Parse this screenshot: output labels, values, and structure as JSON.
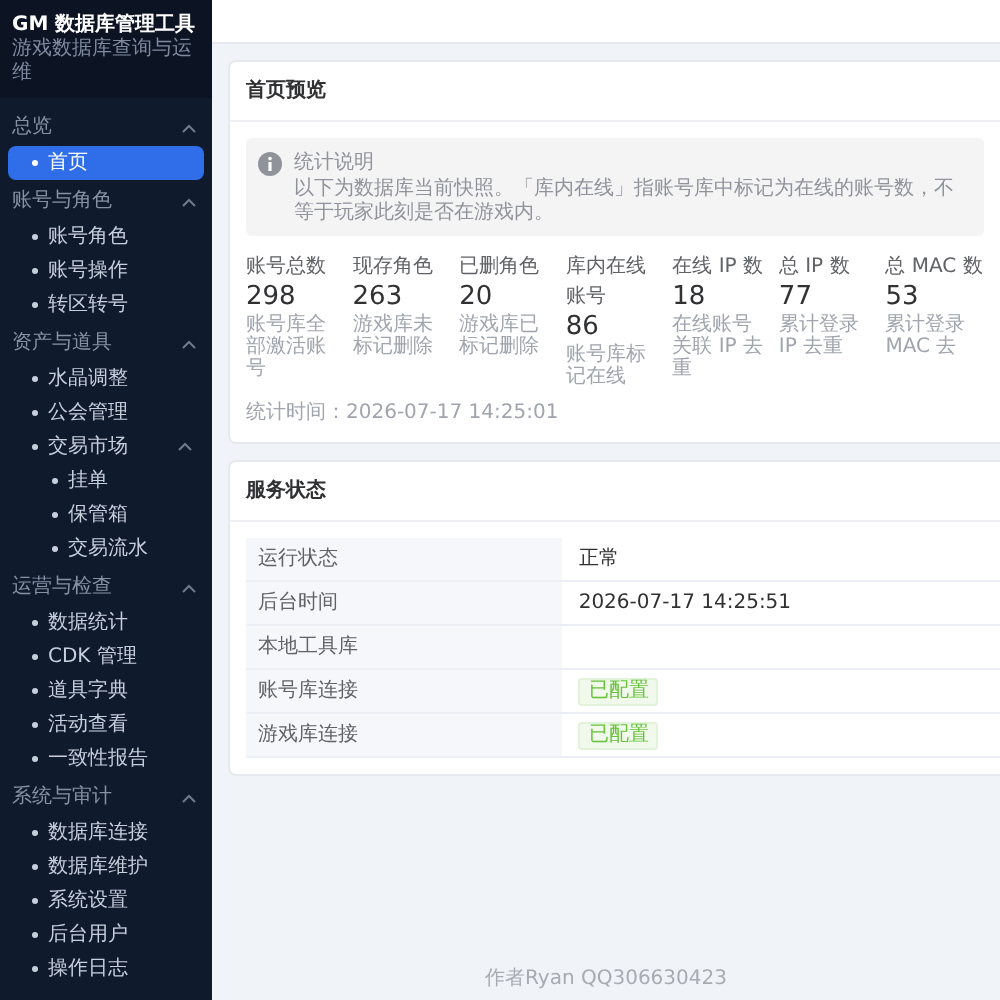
{
  "sidebar": {
    "title": "GM 数据库管理工具",
    "subtitle": "游戏数据库查询与运维",
    "groups": [
      {
        "label": "总览",
        "expanded": true,
        "items": [
          {
            "label": "首页",
            "selected": true
          }
        ]
      },
      {
        "label": "账号与角色",
        "expanded": true,
        "items": [
          {
            "label": "账号角色",
            "selected": false
          },
          {
            "label": "账号操作",
            "selected": false
          },
          {
            "label": "转区转号",
            "selected": false
          }
        ]
      },
      {
        "label": "资产与道具",
        "expanded": true,
        "items": [
          {
            "label": "水晶调整",
            "selected": false
          },
          {
            "label": "公会管理",
            "selected": false
          },
          {
            "label": "交易市场",
            "selected": false,
            "expanded": true,
            "children": [
              {
                "label": "挂单",
                "selected": false
              },
              {
                "label": "保管箱",
                "selected": false
              },
              {
                "label": "交易流水",
                "selected": false
              }
            ]
          }
        ]
      },
      {
        "label": "运营与检查",
        "expanded": true,
        "items": [
          {
            "label": "数据统计",
            "selected": false
          },
          {
            "label": "CDK 管理",
            "selected": false
          },
          {
            "label": "道具字典",
            "selected": false
          },
          {
            "label": "活动查看",
            "selected": false
          },
          {
            "label": "一致性报告",
            "selected": false
          }
        ]
      },
      {
        "label": "系统与审计",
        "expanded": true,
        "items": [
          {
            "label": "数据库连接",
            "selected": false
          },
          {
            "label": "数据库维护",
            "selected": false
          },
          {
            "label": "系统设置",
            "selected": false
          },
          {
            "label": "后台用户",
            "selected": false
          },
          {
            "label": "操作日志",
            "selected": false
          }
        ]
      }
    ]
  },
  "overview": {
    "title": "首页预览",
    "notice": {
      "title": "统计说明",
      "text": "以下为数据库当前快照。「库内在线」指账号库中标记为在线的账号数，不等于玩家此刻是否在游戏内。"
    },
    "stats": [
      {
        "label": "账号总数",
        "value": "298",
        "caption": "账号库全部激活账号"
      },
      {
        "label": "现存角色",
        "value": "263",
        "caption": "游戏库未标记删除"
      },
      {
        "label": "已删角色",
        "value": "20",
        "caption": "游戏库已标记删除"
      },
      {
        "label": "库内在线账号",
        "value": "86",
        "caption": "账号库标记在线"
      },
      {
        "label": "在线 IP 数",
        "value": "18",
        "caption": "在线账号关联 IP 去重"
      },
      {
        "label": "总 IP 数",
        "value": "77",
        "caption": "累计登录 IP 去重"
      },
      {
        "label": "总 MAC 数",
        "value": "53",
        "caption": "累计登录 MAC 去"
      }
    ],
    "timestamp": "统计时间：2026-07-17 14:25:01"
  },
  "status": {
    "title": "服务状态",
    "rows": [
      {
        "label": "运行状态",
        "kind": "text",
        "value": "正常"
      },
      {
        "label": "后台时间",
        "kind": "text",
        "value": "2026-07-17 14:25:51"
      },
      {
        "label": "本地工具库",
        "kind": "empty"
      },
      {
        "label": "账号库连接",
        "kind": "badge",
        "value": "已配置"
      },
      {
        "label": "游戏库连接",
        "kind": "badge",
        "value": "已配置"
      }
    ]
  },
  "footer": "作者Ryan QQ306630423"
}
